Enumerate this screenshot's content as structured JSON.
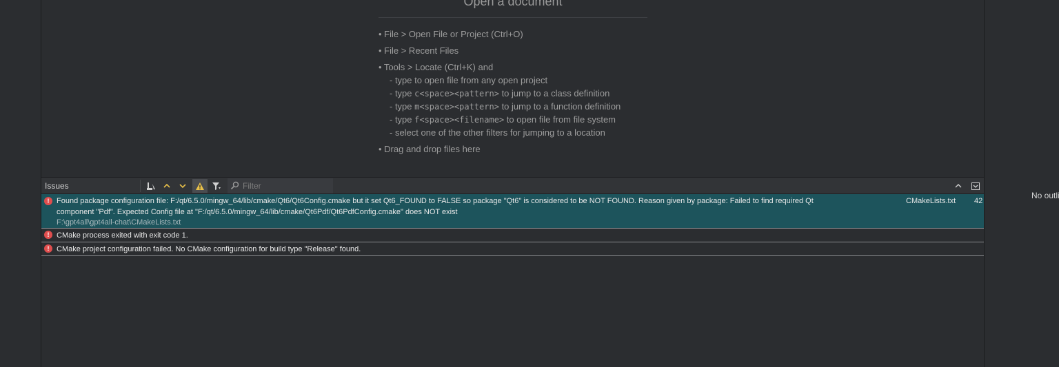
{
  "welcome": {
    "title": "Open a document",
    "items": [
      "• File > Open File or Project (Ctrl+O)",
      "• File > Recent Files",
      "• Tools > Locate (Ctrl+K) and"
    ],
    "sub_items": [
      {
        "pre": "- type to open file from any open project",
        "code": "",
        "post": ""
      },
      {
        "pre": "- type ",
        "code": "c<space><pattern>",
        "post": " to jump to a class definition"
      },
      {
        "pre": "- type ",
        "code": "m<space><pattern>",
        "post": " to jump to a function definition"
      },
      {
        "pre": "- type ",
        "code": "f<space><filename>",
        "post": " to open file from file system"
      },
      {
        "pre": "- select one of the other filters for jumping to a location",
        "code": "",
        "post": ""
      }
    ],
    "last_item": "• Drag and drop files here"
  },
  "issues": {
    "title": "Issues",
    "filter_placeholder": "Filter",
    "rows": [
      {
        "line1": "Found package configuration file: F:/qt/6.5.0/mingw_64/lib/cmake/Qt6/Qt6Config.cmake but it set Qt6_FOUND to FALSE so package \"Qt6\" is considered to be NOT FOUND.  Reason given by package: Failed to find required Qt",
        "line2": "component \"Pdf\". Expected Config file at \"F:/qt/6.5.0/mingw_64/lib/cmake/Qt6Pdf/Qt6PdfConfig.cmake\" does NOT exist",
        "path": "F:\\gpt4all\\gpt4all-chat\\CMakeLists.txt",
        "file": "CMakeLists.txt",
        "line": "42"
      },
      {
        "line1": "CMake process exited with exit code 1."
      },
      {
        "line1": "CMake project configuration failed. No CMake configuration for build type \"Release\" found."
      }
    ]
  },
  "right_panel": {
    "text": "No outline available"
  },
  "colors": {
    "background": "#2b2d30",
    "selected_row": "#1d545c",
    "error_icon": "#e04e4e",
    "warning_yellow": "#e8c04a"
  }
}
